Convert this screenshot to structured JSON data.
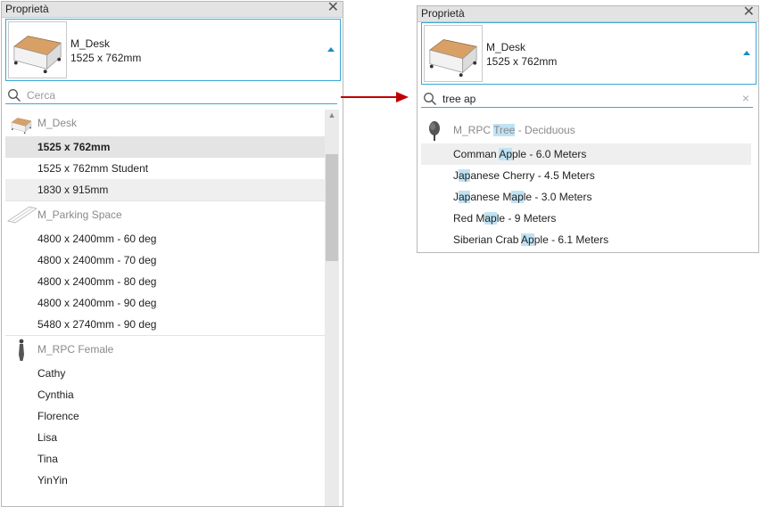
{
  "left": {
    "title": "Proprietà",
    "type_name": "M_Desk",
    "type_size": "1525 x 762mm",
    "search_placeholder": "Cerca",
    "families": [
      {
        "name": "M_Desk",
        "icon": "desk-icon",
        "items": [
          {
            "label": "1525 x 762mm",
            "state": "selected"
          },
          {
            "label": "1525 x 762mm Student",
            "state": ""
          },
          {
            "label": "1830 x 915mm",
            "state": "hover"
          }
        ]
      },
      {
        "name": "M_Parking Space",
        "icon": "parking-space-icon",
        "items": [
          {
            "label": "4800 x 2400mm - 60 deg",
            "state": ""
          },
          {
            "label": "4800 x 2400mm - 70 deg",
            "state": ""
          },
          {
            "label": "4800 x 2400mm - 80 deg",
            "state": ""
          },
          {
            "label": "4800 x 2400mm - 90 deg",
            "state": ""
          },
          {
            "label": "5480 x 2740mm - 90 deg",
            "state": ""
          }
        ]
      },
      {
        "name": "M_RPC Female",
        "icon": "rpc-female-icon",
        "items": [
          {
            "label": "Cathy",
            "state": ""
          },
          {
            "label": "Cynthia",
            "state": ""
          },
          {
            "label": "Florence",
            "state": ""
          },
          {
            "label": "Lisa",
            "state": ""
          },
          {
            "label": "Tina",
            "state": ""
          },
          {
            "label": "YinYin",
            "state": ""
          }
        ]
      }
    ]
  },
  "right": {
    "title": "Proprietà",
    "type_name": "M_Desk",
    "type_size": "1525 x 762mm",
    "search_value": "tree ap",
    "families": [
      {
        "icon": "rpc-tree-icon",
        "name_parts": [
          {
            "text": "M_RPC ",
            "hl": false
          },
          {
            "text": "Tree",
            "hl": true
          },
          {
            "text": " - Deciduous",
            "hl": false
          }
        ],
        "items": [
          {
            "state": "hover",
            "parts": [
              {
                "text": "Comman ",
                "hl": false
              },
              {
                "text": "Ap",
                "hl": true
              },
              {
                "text": "ple - 6.0 Meters",
                "hl": false
              }
            ]
          },
          {
            "state": "",
            "parts": [
              {
                "text": "J",
                "hl": false
              },
              {
                "text": "ap",
                "hl": true
              },
              {
                "text": "anese Cherry - 4.5 Meters",
                "hl": false
              }
            ]
          },
          {
            "state": "",
            "parts": [
              {
                "text": "J",
                "hl": false
              },
              {
                "text": "ap",
                "hl": true
              },
              {
                "text": "anese M",
                "hl": false
              },
              {
                "text": "ap",
                "hl": true
              },
              {
                "text": "le - 3.0 Meters",
                "hl": false
              }
            ]
          },
          {
            "state": "",
            "parts": [
              {
                "text": "Red M",
                "hl": false
              },
              {
                "text": "ap",
                "hl": true
              },
              {
                "text": "le - 9 Meters",
                "hl": false
              }
            ]
          },
          {
            "state": "",
            "parts": [
              {
                "text": "Siberian Crab ",
                "hl": false
              },
              {
                "text": "Ap",
                "hl": true
              },
              {
                "text": "ple - 6.1 Meters",
                "hl": false
              }
            ]
          }
        ]
      }
    ]
  },
  "colors": {
    "accent": "#3aa7d8",
    "arrow": "#c00000",
    "match_highlight": "#bfe3f5",
    "selected_row": "#e4e4e4"
  }
}
